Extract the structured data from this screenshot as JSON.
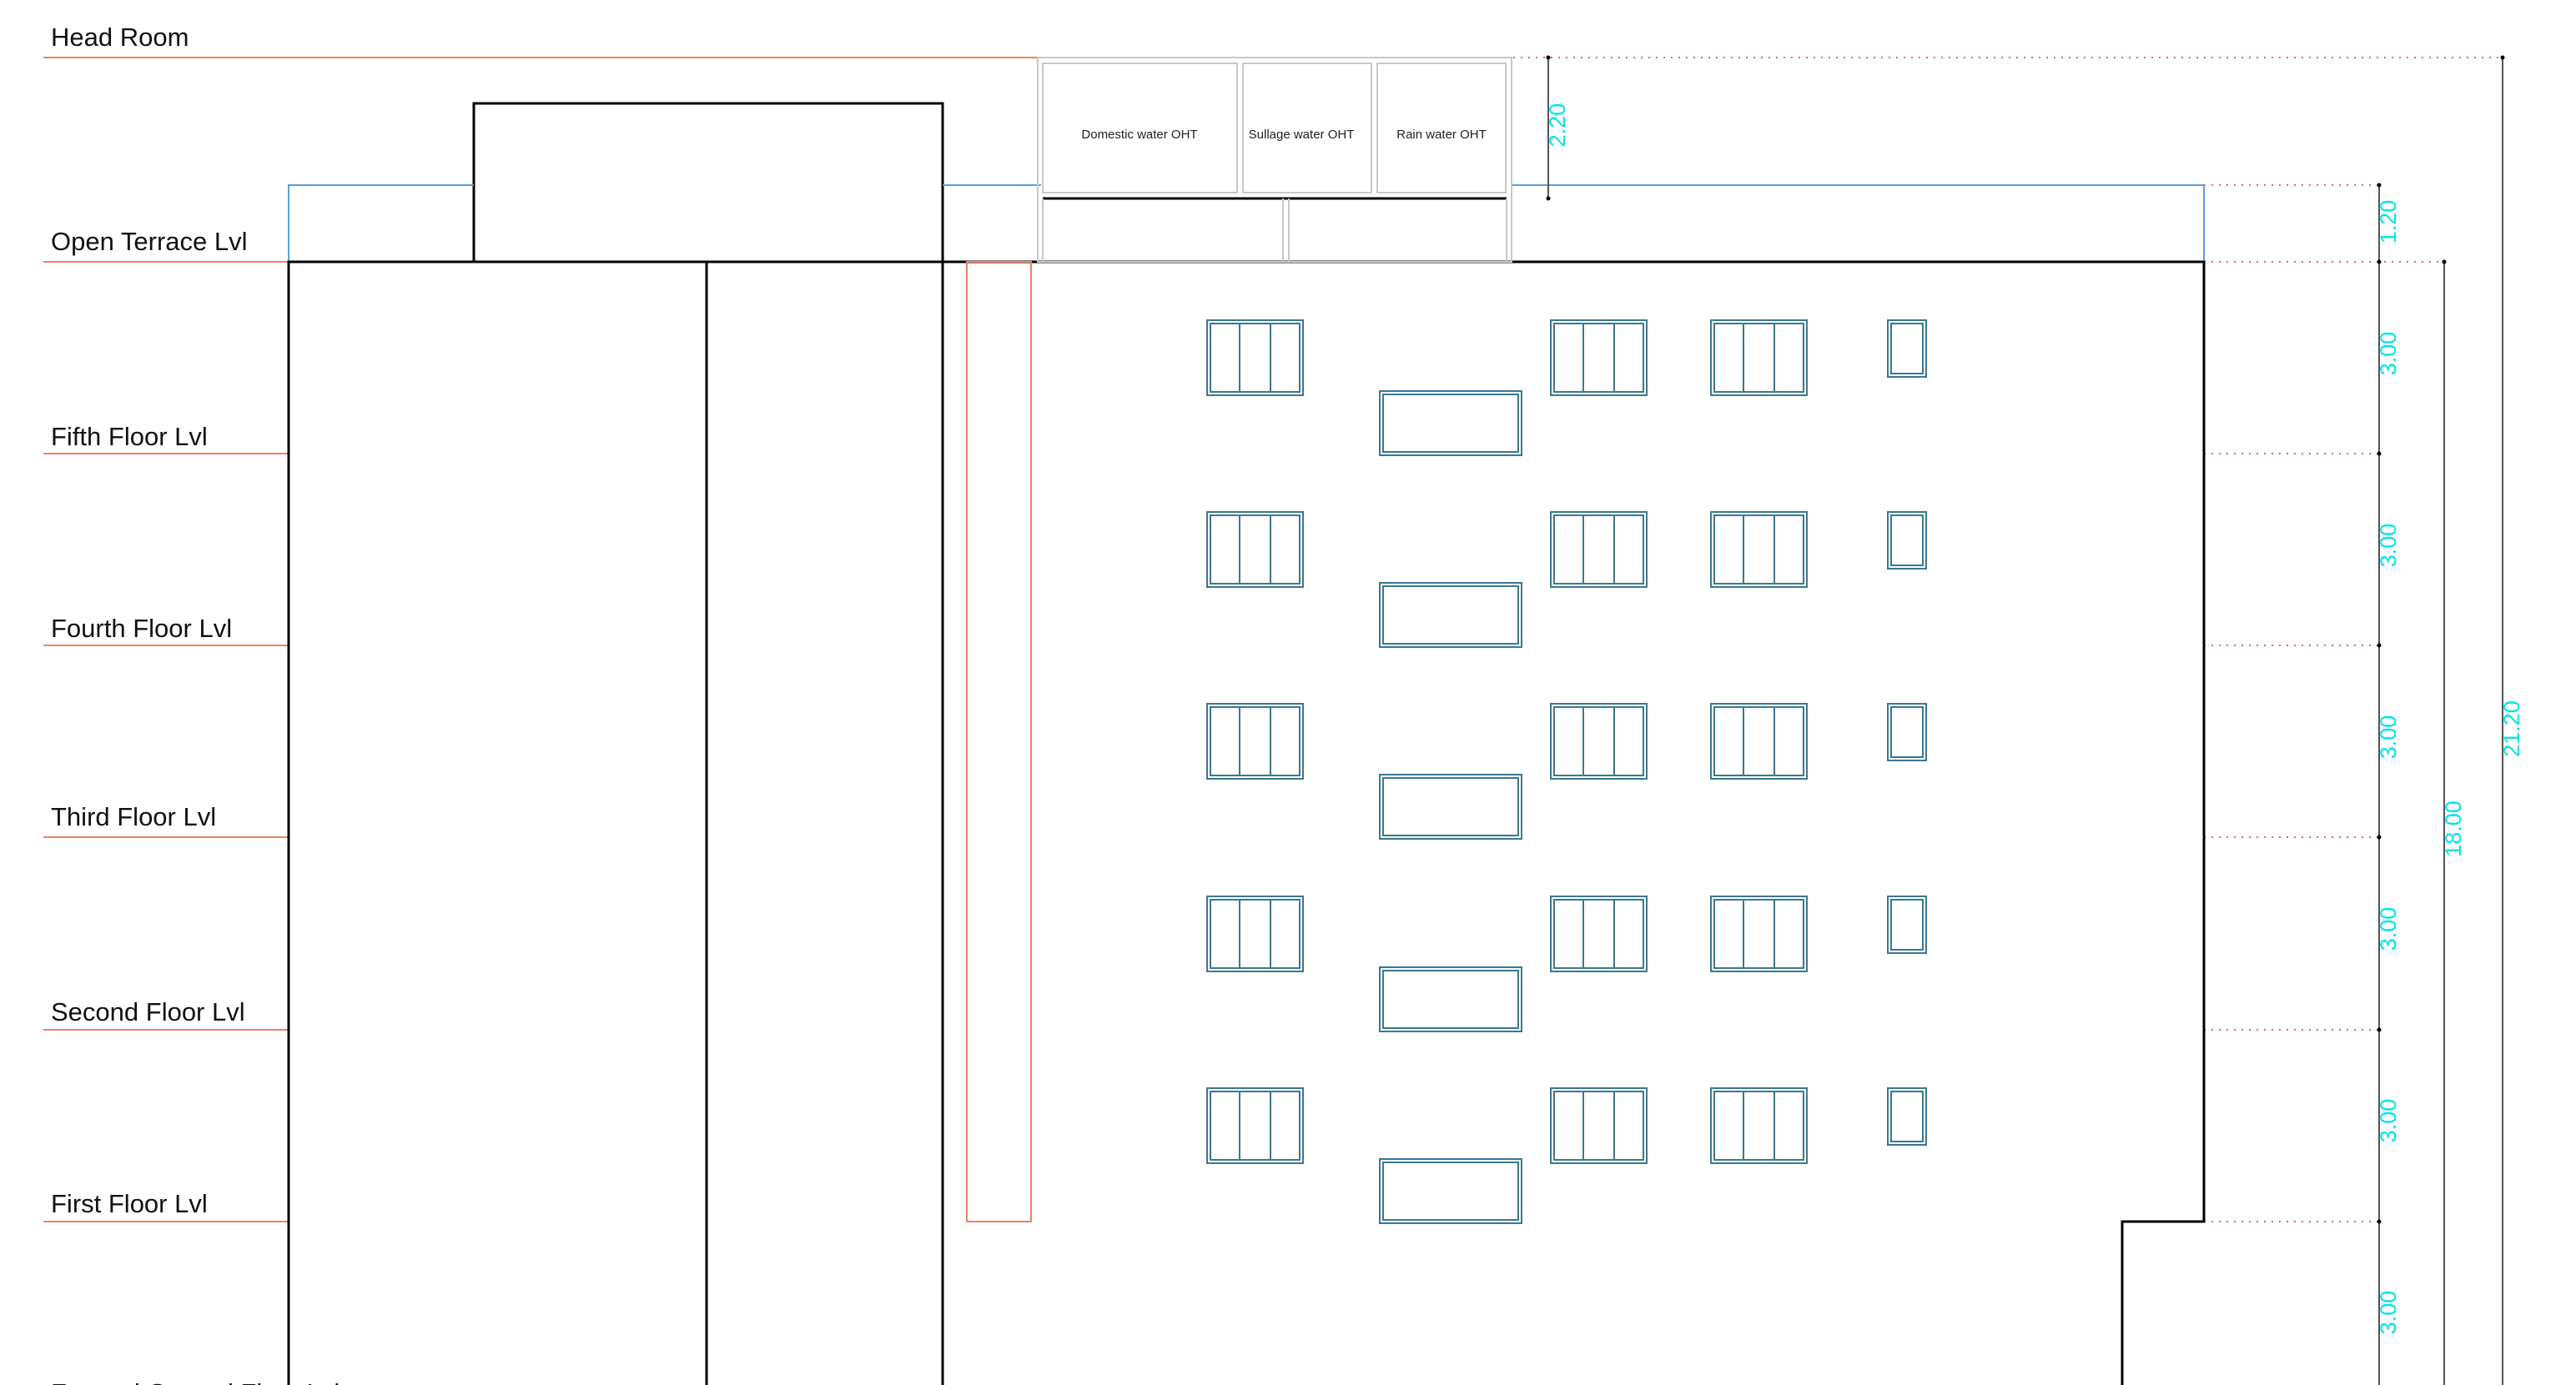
{
  "colors": {
    "level_line": "#f08060",
    "outline": "#000000",
    "parapet": "#5aa0dc",
    "window": "#3a7890",
    "dimension": "#00e5e5",
    "guide": "#f06060",
    "shaft": "#f08060",
    "tank": "#c8c8c8"
  },
  "levels": [
    {
      "id": "head-room",
      "label": "Head Room"
    },
    {
      "id": "open-terrace",
      "label": "Open Terrace Lvl"
    },
    {
      "id": "fifth-floor",
      "label": "Fifth Floor Lvl"
    },
    {
      "id": "fourth-floor",
      "label": "Fourth Floor Lvl"
    },
    {
      "id": "third-floor",
      "label": "Third Floor Lvl"
    },
    {
      "id": "second-floor",
      "label": "Second Floor Lvl"
    },
    {
      "id": "first-floor",
      "label": "First Floor Lvl"
    },
    {
      "id": "formed-ground-floor",
      "label": "Formed Ground Floor Lvl"
    }
  ],
  "tanks": [
    {
      "label": "Domestic water OHT"
    },
    {
      "label": "Sullage water OHT"
    },
    {
      "label": "Rain water OHT"
    }
  ],
  "dimensions": {
    "oht_height": "2.20",
    "parapet_height": "1.20",
    "floor_heights": [
      "3.00",
      "3.00",
      "3.00",
      "3.00",
      "3.00",
      "3.00"
    ],
    "building_height": "18.00",
    "total_height": "21.20"
  },
  "window_floors": [
    "fifth-floor",
    "fourth-floor",
    "third-floor",
    "second-floor",
    "first-floor"
  ],
  "window_types": [
    "triple-casement",
    "ventilator-horizontal",
    "triple-casement",
    "triple-casement",
    "small-ventilator"
  ]
}
